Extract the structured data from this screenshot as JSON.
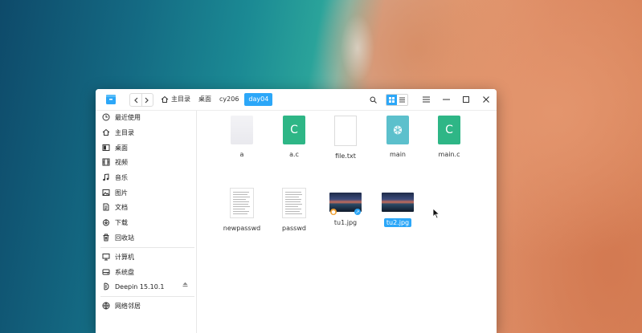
{
  "breadcrumb": {
    "home": "主目录",
    "items": [
      "桌面",
      "cy206",
      "day04"
    ],
    "active_index": 2
  },
  "sidebar": {
    "items": [
      {
        "label": "最近使用",
        "icon": "clock-icon"
      },
      {
        "label": "主目录",
        "icon": "home-icon"
      },
      {
        "label": "桌面",
        "icon": "desktop-icon"
      },
      {
        "label": "视频",
        "icon": "video-icon"
      },
      {
        "label": "音乐",
        "icon": "music-icon"
      },
      {
        "label": "图片",
        "icon": "picture-icon"
      },
      {
        "label": "文档",
        "icon": "document-icon"
      },
      {
        "label": "下载",
        "icon": "download-icon"
      },
      {
        "label": "回收站",
        "icon": "trash-icon"
      },
      {
        "label": "计算机",
        "icon": "computer-icon"
      },
      {
        "label": "系统盘",
        "icon": "disk-icon"
      },
      {
        "label": "Deepin 15.10.1",
        "icon": "deepin-icon"
      },
      {
        "label": "网络邻居",
        "icon": "network-icon"
      }
    ]
  },
  "files": [
    {
      "name": "a",
      "type": "blank"
    },
    {
      "name": "a.c",
      "type": "c",
      "glyph": "C"
    },
    {
      "name": "file.txt",
      "type": "txt"
    },
    {
      "name": "main",
      "type": "binary"
    },
    {
      "name": "main.c",
      "type": "c",
      "glyph": "C"
    },
    {
      "name": "newpasswd",
      "type": "text-lines"
    },
    {
      "name": "passwd",
      "type": "text-lines"
    },
    {
      "name": "tu1.jpg",
      "type": "image"
    },
    {
      "name": "tu2.jpg",
      "type": "image",
      "selected": true
    }
  ],
  "colors": {
    "accent": "#2ca7f8",
    "c_file": "#2eb686",
    "binary_file": "#5cc0cc"
  }
}
